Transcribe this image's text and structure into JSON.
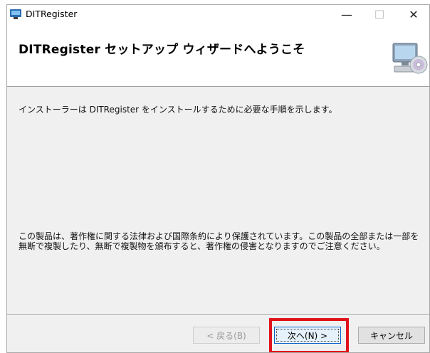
{
  "window": {
    "title": "DITRegister",
    "controls": {
      "minimize": "—",
      "maximize": "☐",
      "close": "✕"
    }
  },
  "banner": {
    "title": "DITRegister セットアップ ウィザードへようこそ",
    "graphic": "computer-cd-icon"
  },
  "body": {
    "intro": "インストーラーは DITRegister をインストールするために必要な手順を示します。",
    "copyright": "この製品は、著作権に関する法律および国際条約により保護されています。この製品の全部または一部を無断で複製したり、無断で複製物を頒布すると、著作権の侵害となりますのでご注意ください。"
  },
  "buttons": {
    "back": "< 戻る(B)",
    "next": "次へ(N) >",
    "cancel": "キャンセル"
  },
  "highlight_color": "#e0131b"
}
